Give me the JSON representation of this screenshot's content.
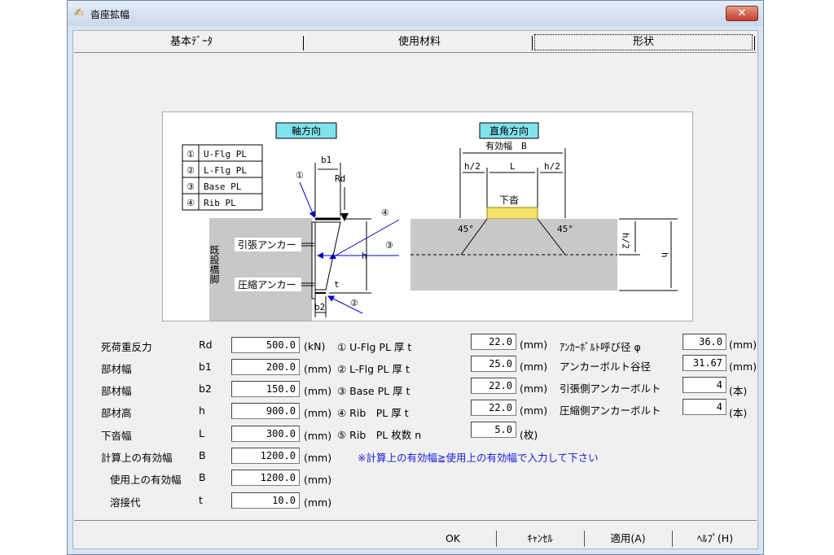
{
  "window": {
    "title": "沓座拡幅",
    "close_glyph": "✕"
  },
  "tabs": [
    {
      "label": "基本ﾃﾞｰﾀ"
    },
    {
      "label": "使用材料"
    },
    {
      "label": "形状"
    }
  ],
  "figure": {
    "axial_title": "軸方向",
    "perpendicular_title": "直角方向",
    "legend": [
      {
        "no": "①",
        "name": "U-Flg PL"
      },
      {
        "no": "②",
        "name": "L-Flg PL"
      },
      {
        "no": "③",
        "name": "Base PL"
      },
      {
        "no": "④",
        "name": "Rib PL"
      }
    ],
    "pier_label": "既設橋脚",
    "tension_anchor": "引張アンカー",
    "compression_anchor": "圧縮アンカー",
    "b1": "b1",
    "b2": "b2",
    "rd": "Rd",
    "h": "h",
    "t": "t",
    "m1": "①",
    "m2": "②",
    "m3": "③",
    "m4": "④",
    "effective_width": "有効幅　B",
    "h_half_left": "h/2",
    "l_label": "L",
    "h_half_right": "h/2",
    "shoe": "下沓",
    "angle_left": "45°",
    "angle_right": "45°",
    "h_half_vert": "h/2",
    "h_vert": "h"
  },
  "form": {
    "left": [
      {
        "label": "死荷重反力",
        "sym": "Rd",
        "value": "500.0",
        "unit": "(kN)"
      },
      {
        "label": "部材幅",
        "sym": "b1",
        "value": "200.0",
        "unit": "(mm)"
      },
      {
        "label": "部材幅",
        "sym": "b2",
        "value": "150.0",
        "unit": "(mm)"
      },
      {
        "label": "部材高",
        "sym": "h",
        "value": "900.0",
        "unit": "(mm)"
      },
      {
        "label": "下沓幅",
        "sym": "L",
        "value": "300.0",
        "unit": "(mm)"
      },
      {
        "label": "計算上の有効幅",
        "sym": "B",
        "value": "1200.0",
        "unit": "(mm)"
      },
      {
        "label": "使用上の有効幅",
        "sym": "B",
        "value": "1200.0",
        "unit": "(mm)"
      },
      {
        "label": "溶接代",
        "sym": "t",
        "value": "10.0",
        "unit": "(mm)"
      }
    ],
    "middle": [
      {
        "label": "① U-Flg PL 厚 t",
        "value": "22.0",
        "unit": "(mm)"
      },
      {
        "label": "② L-Flg PL 厚 t",
        "value": "25.0",
        "unit": "(mm)"
      },
      {
        "label": "③ Base PL 厚 t",
        "value": "22.0",
        "unit": "(mm)"
      },
      {
        "label": "④ Rib　PL 厚 t",
        "value": "22.0",
        "unit": "(mm)"
      },
      {
        "label": "⑤ Rib　PL 枚数 n",
        "value": "5.0",
        "unit": "(枚)"
      }
    ],
    "right": [
      {
        "label": "ｱﾝｶｰﾎﾞﾙﾄ呼び径 φ",
        "value": "36.0",
        "unit": "(mm)"
      },
      {
        "label": "アンカーボルト谷径",
        "value": "31.67",
        "unit": "(mm)"
      },
      {
        "label": "引張側アンカーボルト",
        "value": "4",
        "unit": "(本)"
      },
      {
        "label": "圧縮側アンカーボルト",
        "value": "4",
        "unit": "(本)"
      }
    ],
    "note": "※計算上の有効幅≧使用上の有効幅で入力して下さい"
  },
  "buttons": {
    "ok": "OK",
    "cancel": "ｷｬﾝｾﾙ",
    "apply": "適用(A)",
    "help": "ﾍﾙﾌﾟ(H)"
  }
}
